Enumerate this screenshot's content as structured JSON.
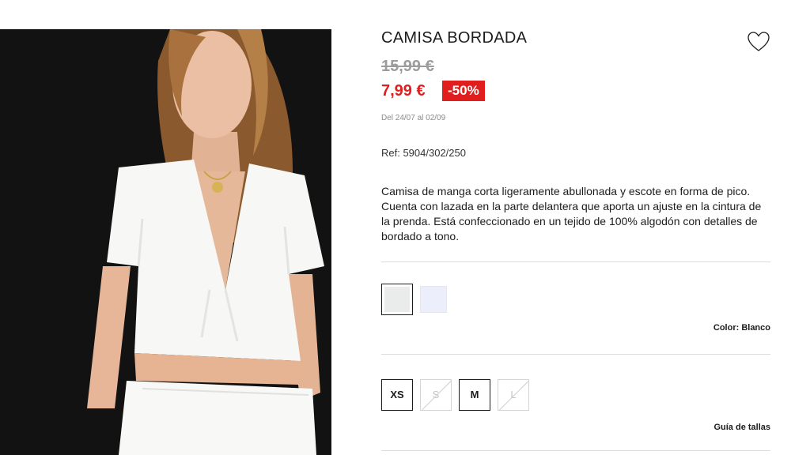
{
  "product": {
    "title": "CAMISA BORDADA",
    "old_price": "15,99 €",
    "new_price": "7,99 €",
    "discount": "-50%",
    "dates": "Del 24/07 al 02/09",
    "ref": "Ref: 5904/302/250",
    "description": "Camisa de manga corta ligeramente abullonada y escote en forma de pico. Cuenta con lazada en la parte delantera que aporta un ajuste en la cintura de la prenda. Está confeccionado en un tejido de 100% algodón con detalles de bordado a tono."
  },
  "colors": {
    "swatches": [
      "#e9ecea",
      "#eceefb"
    ],
    "selected_index": 0,
    "label": "Color: Blanco"
  },
  "sizes": [
    {
      "label": "XS",
      "available": true
    },
    {
      "label": "S",
      "available": false
    },
    {
      "label": "M",
      "available": true
    },
    {
      "label": "L",
      "available": false
    }
  ],
  "size_guide": "Guía de tallas",
  "theme": {
    "sale_red": "#e01e1e",
    "old_price_gray": "#9c9c9c",
    "photo_bg": "#121212"
  },
  "icons": {
    "favorite": "heart-outline-icon"
  }
}
